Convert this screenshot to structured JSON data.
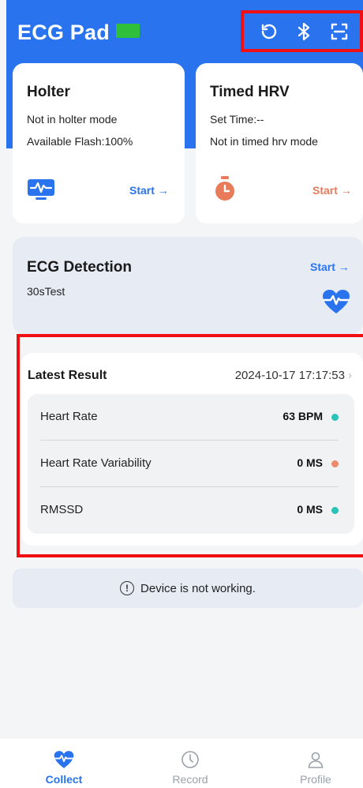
{
  "header": {
    "title": "ECG Pad",
    "battery_color": "#2fbf3a",
    "icons": [
      "refresh-icon",
      "bluetooth-icon",
      "scan-icon"
    ]
  },
  "holter": {
    "title": "Holter",
    "mode": "Not in holter mode",
    "flash": "Available Flash:100%",
    "start": "Start →"
  },
  "timed_hrv": {
    "title": "Timed HRV",
    "set_time": "Set Time:--",
    "mode": "Not in timed hrv mode",
    "start": "Start →"
  },
  "ecg_detection": {
    "title": "ECG Detection",
    "subtitle": "30sTest",
    "start": "Start →"
  },
  "latest_result": {
    "title": "Latest Result",
    "timestamp": "2024-10-17 17:17:53",
    "metrics": [
      {
        "label": "Heart Rate",
        "value": "63 BPM",
        "status_color": "#2bc3b6"
      },
      {
        "label": "Heart Rate Variability",
        "value": "0 MS",
        "status_color": "#ec8a6c"
      },
      {
        "label": "RMSSD",
        "value": "0 MS",
        "status_color": "#2bc3b6"
      }
    ]
  },
  "status": {
    "message": "Device is not working."
  },
  "nav": {
    "collect": "Collect",
    "record": "Record",
    "profile": "Profile"
  },
  "colors": {
    "accent": "#2a73ee",
    "highlight_frame": "#f20f13"
  }
}
